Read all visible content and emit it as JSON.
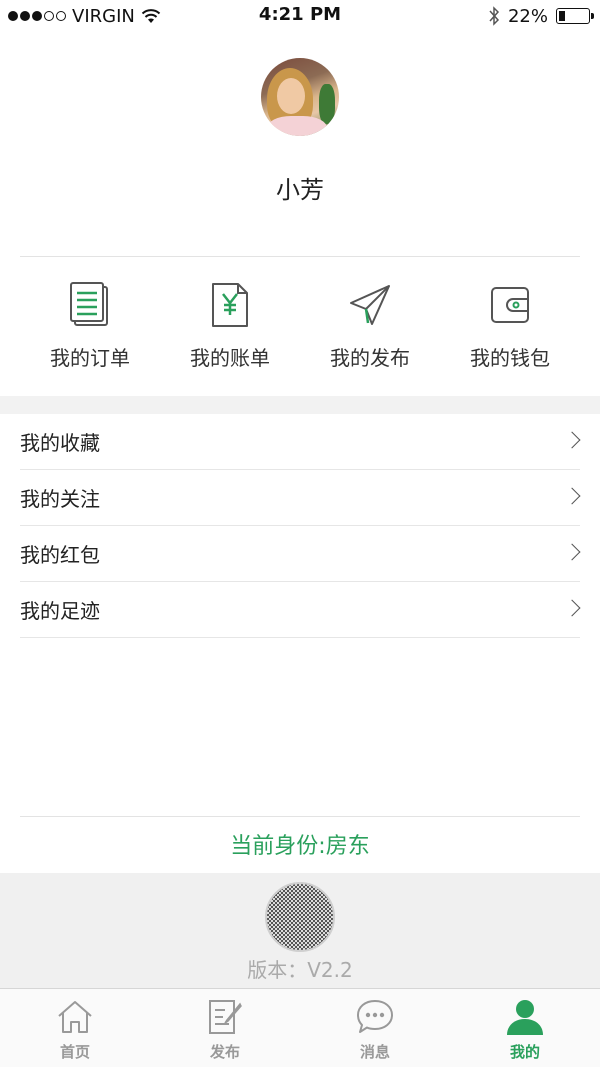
{
  "status_bar": {
    "carrier": "VIRGIN",
    "time": "4:21 PM",
    "battery": "22%",
    "battery_level": 0.22,
    "signal_bars": 3,
    "signal_total": 5
  },
  "profile": {
    "name": "小芳",
    "avatar_icon": "user-photo"
  },
  "actions": [
    {
      "label": "我的订单",
      "icon": "orders-icon"
    },
    {
      "label": "我的账单",
      "icon": "bill-icon"
    },
    {
      "label": "我的发布",
      "icon": "publish-icon"
    },
    {
      "label": "我的钱包",
      "icon": "wallet-icon"
    }
  ],
  "menu": [
    {
      "label": "我的收藏"
    },
    {
      "label": "我的关注"
    },
    {
      "label": "我的红包"
    },
    {
      "label": "我的足迹"
    }
  ],
  "identity": "当前身份:房东",
  "version": "版本：V2.2",
  "tabs": [
    {
      "label": "首页",
      "icon": "home-icon",
      "active": false
    },
    {
      "label": "发布",
      "icon": "edit-icon",
      "active": false
    },
    {
      "label": "消息",
      "icon": "message-icon",
      "active": false
    },
    {
      "label": "我的",
      "icon": "user-icon",
      "active": true
    }
  ],
  "colors": {
    "accent": "#2aa05c",
    "icon_gray": "#555555",
    "divider": "#e6e6e6"
  }
}
